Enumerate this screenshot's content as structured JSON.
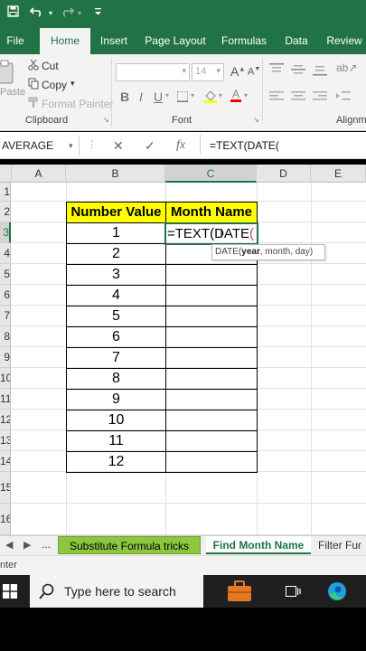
{
  "quick_access": {
    "save_icon": "save-icon",
    "undo_icon": "undo-icon",
    "redo_icon": "redo-icon",
    "customize_icon": "chevron-down-icon"
  },
  "tabs": [
    "File",
    "Home",
    "Insert",
    "Page Layout",
    "Formulas",
    "Data",
    "Review"
  ],
  "active_tab": "Home",
  "ribbon": {
    "clipboard": {
      "paste_label": "Paste",
      "cut_label": "Cut",
      "copy_label": "Copy",
      "format_painter_label": "Format Painter",
      "group_label": "Clipboard"
    },
    "font": {
      "font_name": "",
      "font_size": "14",
      "bold": "B",
      "italic": "I",
      "underline": "U",
      "grow": "A",
      "shrink": "A",
      "group_label": "Font"
    },
    "alignment": {
      "group_label": "Alignm"
    }
  },
  "formula_bar": {
    "name_box": "AVERAGE",
    "cancel_icon": "✕",
    "enter_icon": "✓",
    "fx": "fx",
    "formula": "=TEXT(DATE("
  },
  "grid": {
    "columns": [
      "A",
      "B",
      "C",
      "D",
      "E"
    ],
    "selected_column": "C",
    "row_numbers": [
      "1",
      "2",
      "3",
      "4",
      "5",
      "6",
      "7",
      "8",
      "9",
      "10",
      "11",
      "12",
      "13",
      "14",
      "15",
      "16"
    ],
    "selected_row": "3",
    "table_headers": [
      "Number Value",
      "Month Name"
    ],
    "number_values": [
      "1",
      "2",
      "3",
      "4",
      "5",
      "6",
      "7",
      "8",
      "9",
      "10",
      "11",
      "12"
    ],
    "active_cell": {
      "prefix": "=TEXT(DATE",
      "paren": "("
    },
    "tooltip": {
      "func": "DATE(",
      "arg1": "year",
      "rest": ", month, day)"
    }
  },
  "sheet_tabs": {
    "more": "...",
    "tabs": [
      "Substitute Formula tricks",
      "Find Month Name",
      "Filter Fur"
    ],
    "active": "Find Month Name"
  },
  "status": {
    "mode": "nter"
  },
  "taskbar": {
    "search_placeholder": "Type here to search"
  },
  "colors": {
    "excel_green": "#217346",
    "header_fill": "#ffff00",
    "tab_green": "#8dc63f"
  }
}
